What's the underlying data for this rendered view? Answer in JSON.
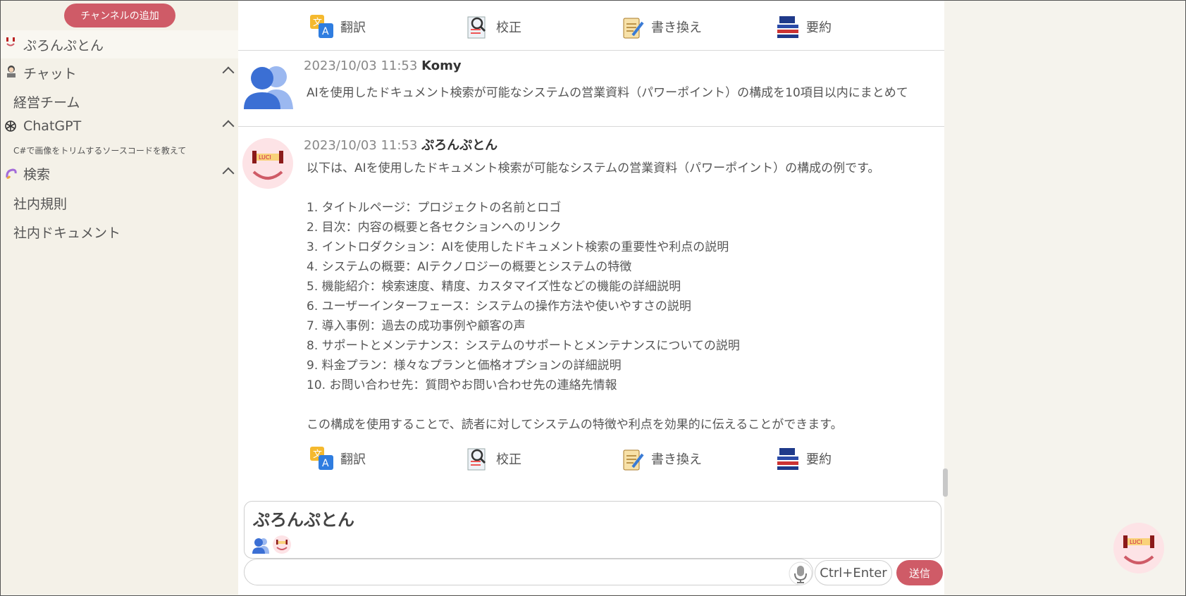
{
  "sidebar": {
    "add_channel": "チャンネルの追加",
    "items": [
      {
        "label": "ぷろんぷとん",
        "icon": "bot-face-icon"
      },
      {
        "label": "チャット",
        "icon": "chat-avatar-icon"
      },
      {
        "label": "経営チーム"
      },
      {
        "label": "ChatGPT",
        "icon": "openai-icon"
      },
      {
        "label": "C#で画像をトリムするソースコードを教えて"
      },
      {
        "label": "検索",
        "icon": "search-swirl-icon"
      },
      {
        "label": "社内規則"
      },
      {
        "label": "社内ドキュメント"
      }
    ]
  },
  "toolbar": {
    "translate": "翻訳",
    "proofread": "校正",
    "rewrite": "書き換え",
    "summarize": "要約"
  },
  "messages": [
    {
      "time": "2023/10/03 11:53",
      "author": "Komy",
      "text": "AIを使用したドキュメント検索が可能なシステムの営業資料（パワーポイント）の構成を10項目以内にまとめて"
    },
    {
      "time": "2023/10/03 11:53",
      "author": "ぷろんぷとん",
      "lines": [
        "以下は、AIを使用したドキュメント検索が可能なシステムの営業資料（パワーポイント）の構成の例です。",
        "",
        "1. タイトルページ：プロジェクトの名前とロゴ",
        "2. 目次：内容の概要と各セクションへのリンク",
        "3. イントロダクション：AIを使用したドキュメント検索の重要性や利点の説明",
        "4. システムの概要：AIテクノロジーの概要とシステムの特徴",
        "5. 機能紹介：検索速度、精度、カスタマイズ性などの機能の詳細説明",
        "6. ユーザーインターフェース：システムの操作方法や使いやすさの説明",
        "7. 導入事例：過去の成功事例や顧客の声",
        "8. サポートとメンテナンス：システムのサポートとメンテナンスについての説明",
        "9. 料金プラン：様々なプランと価格オプションの詳細説明",
        "10. お問い合わせ先：質問やお問い合わせ先の連絡先情報",
        "",
        "この構成を使用することで、読者に対してシステムの特徴や利点を効果的に伝えることができます。"
      ]
    }
  ],
  "composer": {
    "mention": "ぷろんぷとん",
    "input_value": "",
    "shortcut": "Ctrl+Enter",
    "send": "送信"
  },
  "colors": {
    "accent": "#cf5b67",
    "sidebar_bg": "#f4f1e8",
    "user_avatar": "#3b6fd4"
  }
}
